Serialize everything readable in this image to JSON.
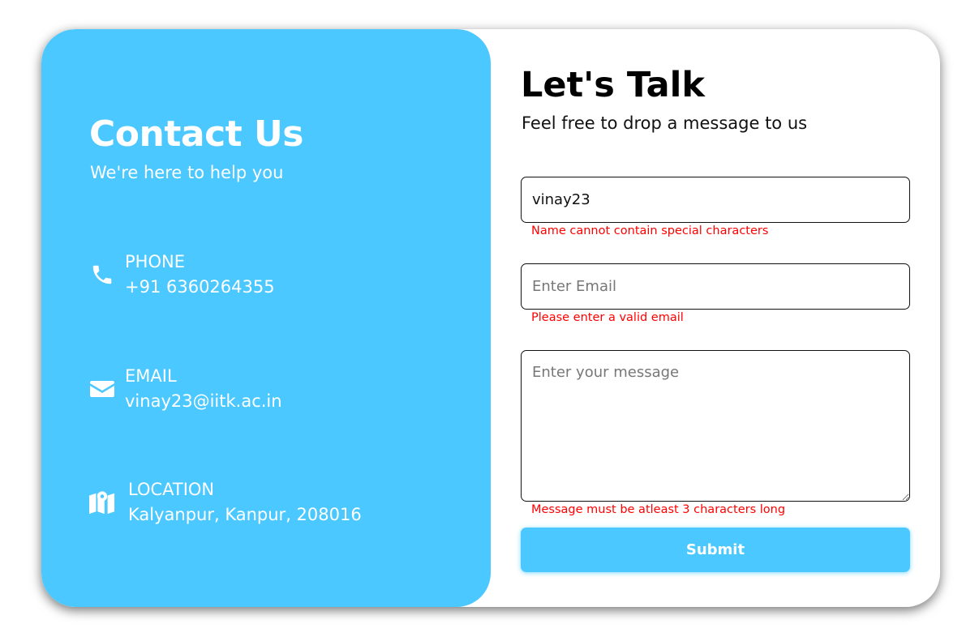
{
  "left_panel": {
    "title": "Contact Us",
    "subtitle": "We're here to help you",
    "phone": {
      "label": "PHONE",
      "value": "+91 6360264355",
      "icon": "phone-icon"
    },
    "email": {
      "label": "EMAIL",
      "value": "vinay23@iitk.ac.in",
      "icon": "envelope-icon"
    },
    "location": {
      "label": "LOCATION",
      "value": "Kalyanpur, Kanpur, 208016",
      "icon": "map-pin-icon"
    }
  },
  "form": {
    "title": "Let's Talk",
    "subtitle": "Feel free to drop a message to us",
    "name_value": "vinay23",
    "name_error": "Name cannot contain special characters",
    "email_value": "",
    "email_placeholder": "Enter Email",
    "email_error": "Please enter a valid email",
    "message_value": "",
    "message_placeholder": "Enter your message",
    "message_error": "Message must be atleast 3 characters long",
    "submit_label": "Submit"
  },
  "colors": {
    "accent": "#4ac8ff",
    "error": "#ff0000",
    "text": "#000000"
  }
}
